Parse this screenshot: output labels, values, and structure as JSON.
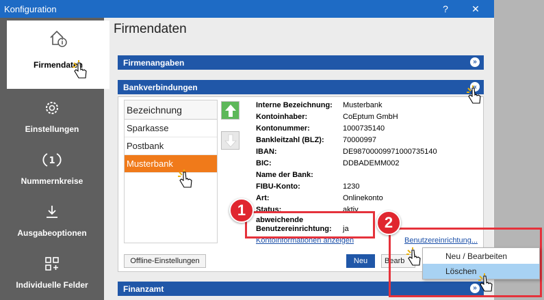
{
  "window": {
    "title": "Konfiguration",
    "help_label": "?",
    "close_label": "✕"
  },
  "sidebar": {
    "items": [
      {
        "label": "Firmendaten",
        "icon": "house-info-icon"
      },
      {
        "label": "Einstellungen",
        "icon": "gear-icon"
      },
      {
        "label": "Nummernkreise",
        "icon": "number-cycle-icon"
      },
      {
        "label": "Ausgabeoptionen",
        "icon": "download-icon"
      },
      {
        "label": "Individuelle Felder",
        "icon": "grid-plus-icon"
      }
    ]
  },
  "page": {
    "title": "Firmendaten"
  },
  "sections": {
    "firmenangaben": "Firmenangaben",
    "bankverbindungen": "Bankverbindungen",
    "finanzamt": "Finanzamt"
  },
  "bank_list": {
    "header": "Bezeichnung",
    "items": [
      "Sparkasse",
      "Postbank",
      "Musterbank"
    ],
    "selected": "Musterbank"
  },
  "details": [
    {
      "label": "Interne Bezeichnung:",
      "value": "Musterbank"
    },
    {
      "label": "Kontoinhaber:",
      "value": "CoEptum GmbH"
    },
    {
      "label": "Kontonummer:",
      "value": "1000735140"
    },
    {
      "label": "Bankleitzahl (BLZ):",
      "value": "70000997"
    },
    {
      "label": "IBAN:",
      "value": "DE98700009971000735140"
    },
    {
      "label": "BIC:",
      "value": "DDBADEMM002"
    },
    {
      "label": "Name der Bank:",
      "value": ""
    },
    {
      "label": "FIBU-Konto:",
      "value": "1230"
    },
    {
      "label": "Art:",
      "value": "Onlinekonto"
    },
    {
      "label": "Status:",
      "value": "aktiv"
    }
  ],
  "abweichende": {
    "label_line1": "abweichende",
    "label_line2": "Benutzereinrichtung:",
    "value": "ja"
  },
  "links": {
    "kontoinformationen": "Kontoinformationen anzeigen",
    "benutzereinrichtung": "Benutzereinrichtung..."
  },
  "buttons": {
    "offline": "Offline-Einstellungen",
    "neu": "Neu",
    "bearbeiten": "Bearb"
  },
  "context_menu": {
    "items": [
      "Neu / Bearbeiten",
      "Löschen"
    ],
    "highlighted": "Löschen"
  },
  "badges": [
    "1",
    "2"
  ],
  "colors": {
    "accent": "#2057a8",
    "titlebar": "#1e6bc5",
    "selection": "#f07a1a",
    "highlight_box": "#e5323b",
    "sidebar": "#5f5f5f"
  }
}
